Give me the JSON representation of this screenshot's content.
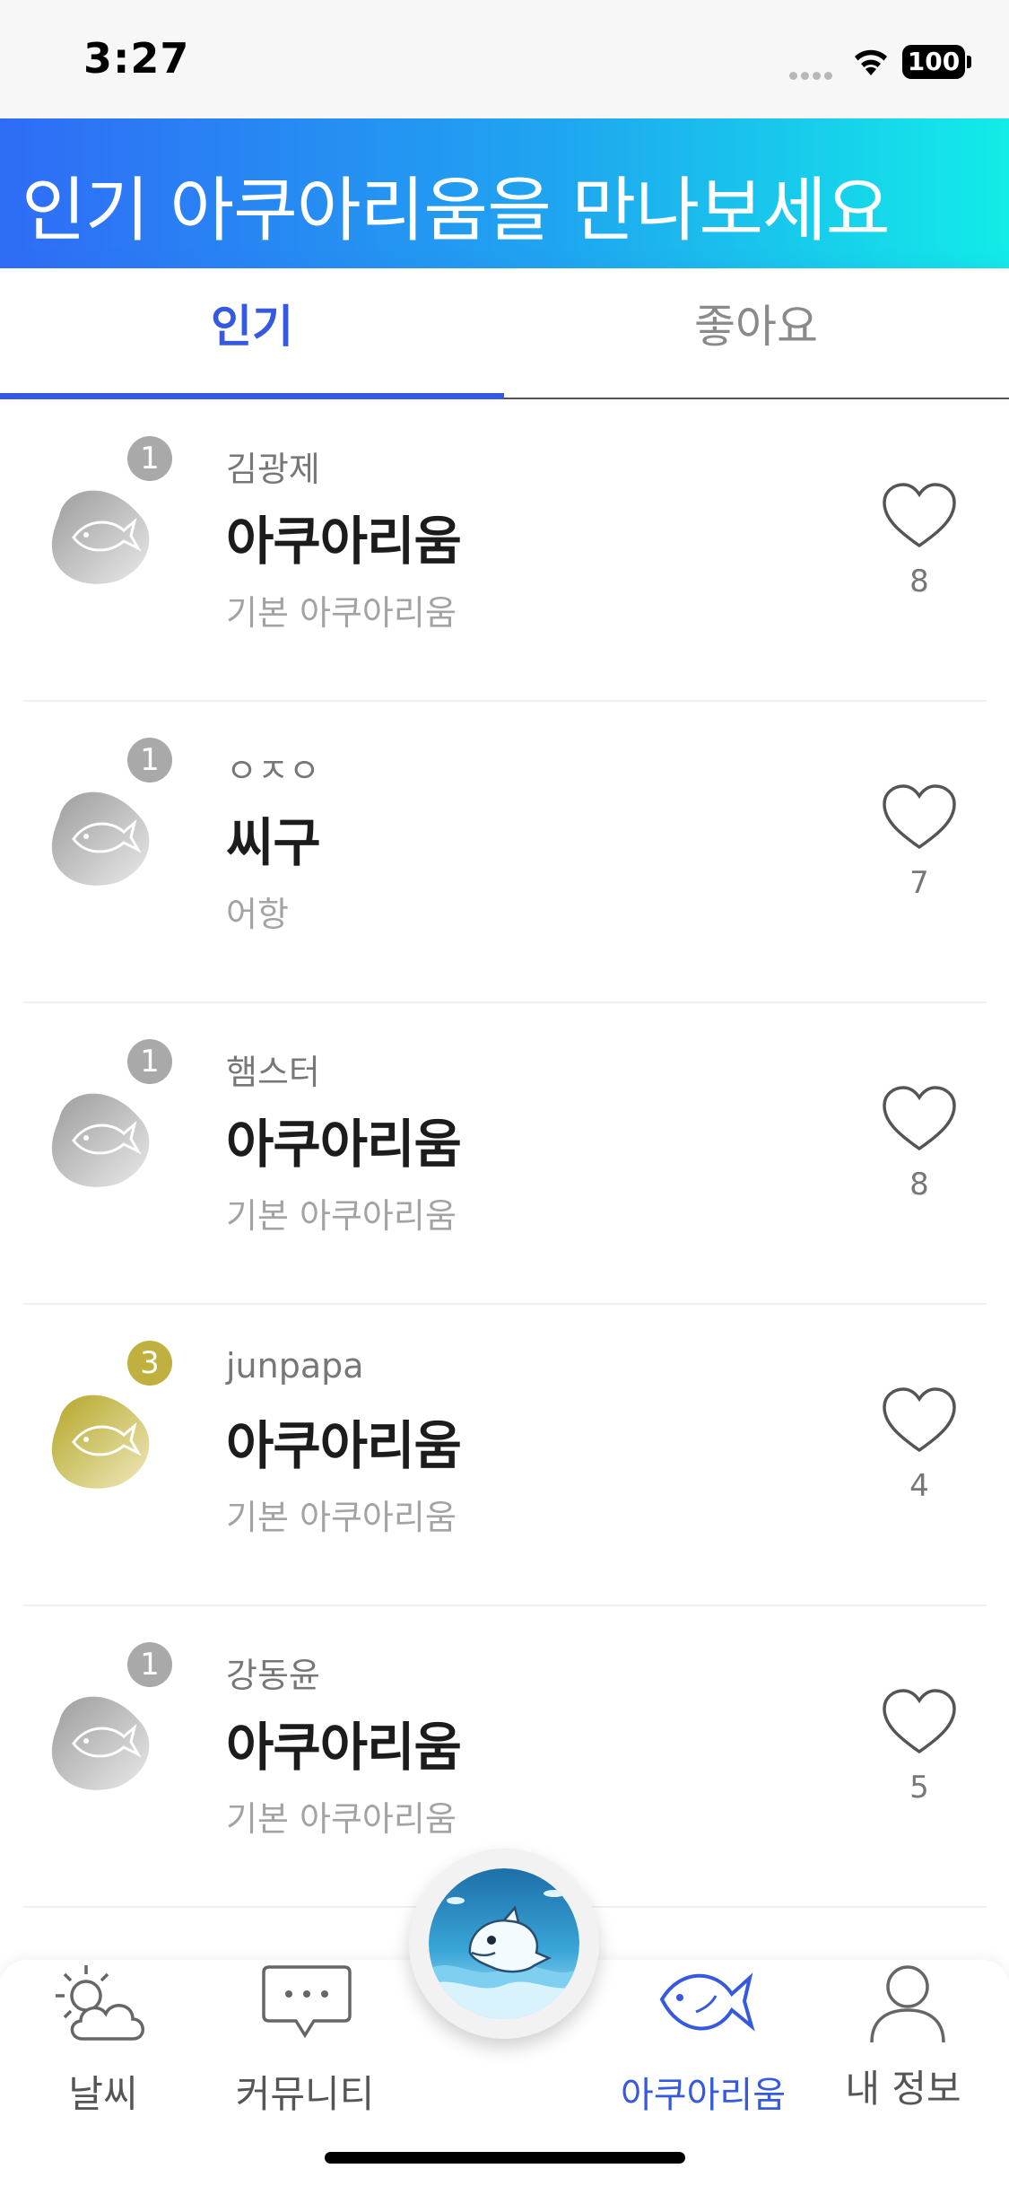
{
  "status_bar": {
    "time": "3:27",
    "battery": "100"
  },
  "banner": {
    "title": "인기 아쿠아리움을 만나보세요"
  },
  "tabs": [
    {
      "label": "인기",
      "active": true
    },
    {
      "label": "좋아요",
      "active": false
    }
  ],
  "aquariums": [
    {
      "rank": "1",
      "rank_color": "#a9a9a9",
      "author": "김광제",
      "name": "아쿠아리움",
      "type": "기본 아쿠아리움",
      "likes": "8"
    },
    {
      "rank": "1",
      "rank_color": "#a9a9a9",
      "author": "ㅇㅈㅇ",
      "name": "씨구",
      "type": "어항",
      "likes": "7"
    },
    {
      "rank": "1",
      "rank_color": "#a9a9a9",
      "author": "햄스터",
      "name": "아쿠아리움",
      "type": "기본 아쿠아리움",
      "likes": "8"
    },
    {
      "rank": "3",
      "rank_color": "#bfb040",
      "author": "junpapa",
      "name": "아쿠아리움",
      "type": "기본 아쿠아리움",
      "likes": "4"
    },
    {
      "rank": "1",
      "rank_color": "#a9a9a9",
      "author": "강동윤",
      "name": "아쿠아리움",
      "type": "기본 아쿠아리움",
      "likes": "5"
    }
  ],
  "nav": {
    "weather": "날씨",
    "community": "커뮤니티",
    "aquarium": "아쿠아리움",
    "my_info": "내 정보"
  },
  "colors": {
    "accent": "#3559e0",
    "banner_start": "#2f6cf6",
    "banner_end": "#12ece8"
  }
}
